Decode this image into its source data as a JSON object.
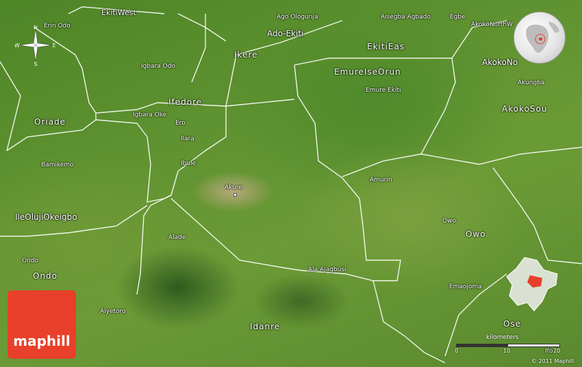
{
  "map": {
    "regions": [
      {
        "id": "ekitiwest",
        "name": "EkitiWest"
      },
      {
        "id": "ado-ekiti",
        "name": "Ado-Ekiti"
      },
      {
        "id": "ikere",
        "name": "Ikere"
      },
      {
        "id": "ekitieas",
        "name": "EkitiEas"
      },
      {
        "id": "emureiseorun",
        "name": "EmureIseOrun"
      },
      {
        "id": "ifedore",
        "name": "Ifedore"
      },
      {
        "id": "oriade",
        "name": "Oriade"
      },
      {
        "id": "akokono",
        "name": "AkokoNo"
      },
      {
        "id": "akokosou",
        "name": "AkokoSou"
      },
      {
        "id": "ileolujiokeigbo",
        "name": "IleOlujiOkeigbo"
      },
      {
        "id": "owo",
        "name": "Owo"
      },
      {
        "id": "ondo",
        "name": "Ondo"
      },
      {
        "id": "idanre",
        "name": "Idanre"
      },
      {
        "id": "ose",
        "name": "Ose"
      }
    ],
    "towns": [
      {
        "id": "erin-odo",
        "name": "Erin Odo"
      },
      {
        "id": "ago-ologunja",
        "name": "Ago Ologunja"
      },
      {
        "id": "aisegba-agbado",
        "name": "Aisegba Agbado"
      },
      {
        "id": "egbe",
        "name": "Egbe"
      },
      {
        "id": "akokonorthw",
        "name": "AkokoNorthW"
      },
      {
        "id": "igbara-odo",
        "name": "Igbara Odo"
      },
      {
        "id": "emure-ekiti",
        "name": "Emure Ekiti"
      },
      {
        "id": "akungba",
        "name": "Akungba"
      },
      {
        "id": "igbara-oke",
        "name": "Igbara Oke"
      },
      {
        "id": "ero",
        "name": "Ero"
      },
      {
        "id": "ilara",
        "name": "Ilara"
      },
      {
        "id": "ibule",
        "name": "Ibule"
      },
      {
        "id": "bamikemo",
        "name": "Bamikemo"
      },
      {
        "id": "akure",
        "name": "Akure"
      },
      {
        "id": "amurin",
        "name": "Amurin"
      },
      {
        "id": "owo-town",
        "name": "Owo"
      },
      {
        "id": "alade",
        "name": "Alade"
      },
      {
        "id": "ala-ajagbusi",
        "name": "Ala Ajagbusi"
      },
      {
        "id": "ondo-town",
        "name": "Ondo"
      },
      {
        "id": "emaojoma",
        "name": "Emaojoma"
      },
      {
        "id": "aiyetoro",
        "name": "Aiyetoro"
      },
      {
        "id": "ifo",
        "name": "Ifo"
      }
    ],
    "compass": {
      "n": "N",
      "s": "S",
      "e": "E",
      "w": "W"
    },
    "scale": {
      "unit": "kilometers",
      "ticks": [
        "0",
        "10",
        "20"
      ]
    },
    "copyright": "© 2011 Maphill",
    "logo": "maphill",
    "colors": {
      "brand": "#e8402a",
      "inset_highlight": "#e8402a",
      "roads": "#ffffff"
    }
  }
}
